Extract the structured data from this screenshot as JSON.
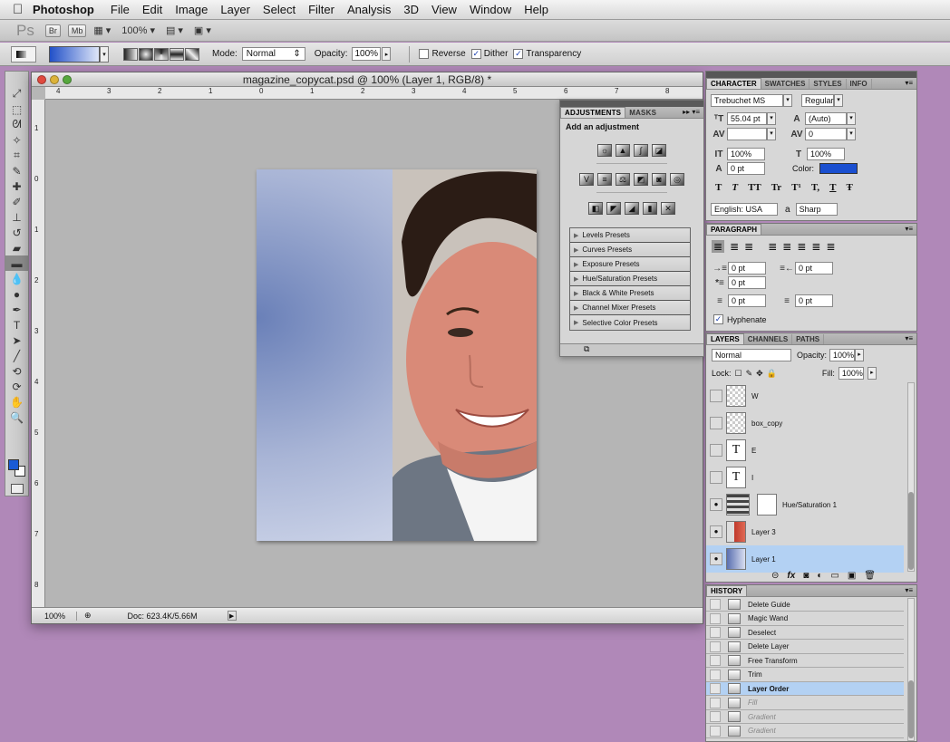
{
  "menubar": {
    "apple": "",
    "app": "Photoshop",
    "items": [
      "File",
      "Edit",
      "Image",
      "Layer",
      "Select",
      "Filter",
      "Analysis",
      "3D",
      "View",
      "Window",
      "Help"
    ]
  },
  "appbar": {
    "logo": "Ps",
    "br": "Br",
    "mb": "Mb",
    "zoom": "100%"
  },
  "options": {
    "mode_label": "Mode:",
    "mode_value": "Normal",
    "opacity_label": "Opacity:",
    "opacity_value": "100%",
    "reverse": "Reverse",
    "dither": "Dither",
    "transparency": "Transparency",
    "gradient_colors": [
      "#2150c8",
      "#dfe6f8"
    ]
  },
  "document": {
    "title": "magazine_copycat.psd @ 100% (Layer 1, RGB/8) *",
    "zoom": "100%",
    "doc_info": "Doc: 623.4K/5.66M",
    "ruler_top": [
      "4",
      "3",
      "2",
      "1",
      "0",
      "1",
      "2",
      "3",
      "4",
      "5",
      "6",
      "7",
      "8"
    ],
    "ruler_left": [
      "1",
      "0",
      "1",
      "2",
      "3",
      "4",
      "5",
      "6",
      "7",
      "8"
    ]
  },
  "adjustments": {
    "tabs": [
      "ADJUSTMENTS",
      "MASKS"
    ],
    "heading": "Add an adjustment",
    "presets": [
      "Levels Presets",
      "Curves Presets",
      "Exposure Presets",
      "Hue/Saturation Presets",
      "Black & White Presets",
      "Channel Mixer Presets",
      "Selective Color Presets"
    ]
  },
  "character": {
    "tabs": [
      "CHARACTER",
      "SWATCHES",
      "STYLES",
      "INFO"
    ],
    "font_family": "Trebuchet MS",
    "font_style": "Regular",
    "font_size": "55.04 pt",
    "leading": "(Auto)",
    "kerning": "",
    "tracking": "0",
    "vscale": "100%",
    "hscale": "100%",
    "baseline": "0 pt",
    "color_label": "Color:",
    "color_value": "#1a4fd0",
    "language": "English: USA",
    "aa_label": "a",
    "aa_value": "Sharp",
    "type_buttons": [
      "T",
      "T",
      "TT",
      "Tr",
      "T¹",
      "T,",
      "T",
      "Ŧ"
    ]
  },
  "paragraph": {
    "tab": "PARAGRAPH",
    "indent_left": "0 pt",
    "indent_right": "0 pt",
    "indent_first": "0 pt",
    "space_before": "0 pt",
    "space_after": "0 pt",
    "hyphenate": "Hyphenate"
  },
  "layers": {
    "tabs": [
      "LAYERS",
      "CHANNELS",
      "PATHS"
    ],
    "blend_mode": "Normal",
    "opacity_label": "Opacity:",
    "opacity_value": "100%",
    "lock_label": "Lock:",
    "fill_label": "Fill:",
    "fill_value": "100%",
    "items": [
      {
        "name": "W",
        "kind": "raster",
        "visible": false,
        "selected": false
      },
      {
        "name": "box_copy",
        "kind": "raster",
        "visible": false,
        "selected": false
      },
      {
        "name": "E",
        "kind": "text",
        "visible": false,
        "selected": false
      },
      {
        "name": "I",
        "kind": "text",
        "visible": false,
        "selected": false
      },
      {
        "name": "Hue/Saturation 1",
        "kind": "adjustment",
        "visible": true,
        "selected": false
      },
      {
        "name": "Layer 3",
        "kind": "photo",
        "visible": true,
        "selected": false
      },
      {
        "name": "Layer 1",
        "kind": "gradient",
        "visible": true,
        "selected": true
      }
    ],
    "footer_icons": [
      "link-icon",
      "fx-icon",
      "mask-icon",
      "adjustment-icon",
      "group-icon",
      "new-layer-icon",
      "trash-icon"
    ]
  },
  "history": {
    "tab": "HISTORY",
    "items": [
      {
        "name": "Delete Guide",
        "state": "normal"
      },
      {
        "name": "Magic Wand",
        "state": "normal"
      },
      {
        "name": "Deselect",
        "state": "normal"
      },
      {
        "name": "Delete Layer",
        "state": "normal"
      },
      {
        "name": "Free Transform",
        "state": "normal"
      },
      {
        "name": "Trim",
        "state": "normal"
      },
      {
        "name": "Layer Order",
        "state": "selected"
      },
      {
        "name": "Fill",
        "state": "dim"
      },
      {
        "name": "Gradient",
        "state": "dim"
      },
      {
        "name": "Gradient",
        "state": "dim"
      }
    ]
  }
}
